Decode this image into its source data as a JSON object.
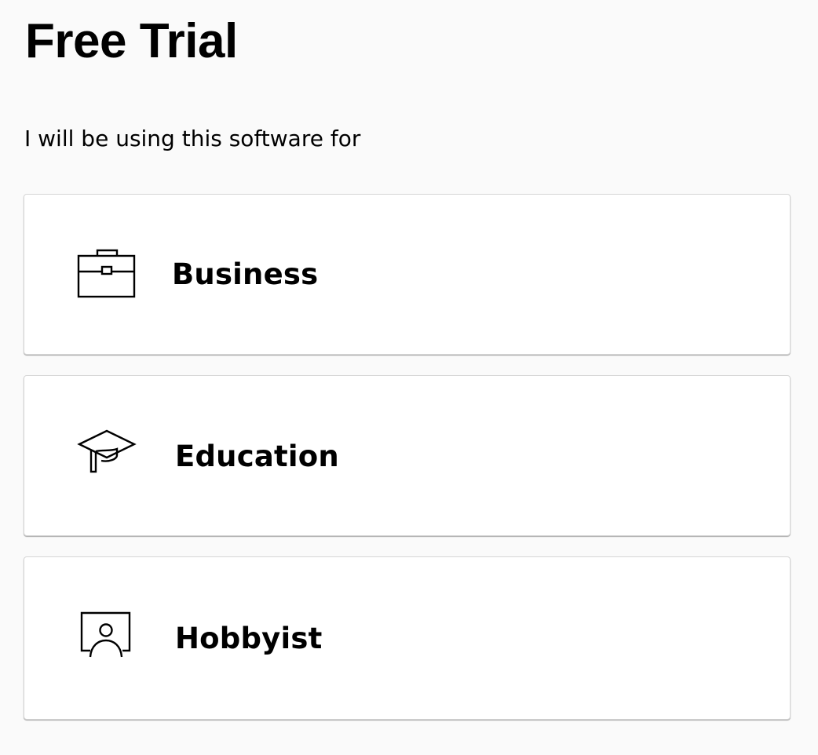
{
  "page": {
    "title": "Free Trial",
    "prompt": "I will be using this software for"
  },
  "options": [
    {
      "label": "Business",
      "icon": "briefcase-icon"
    },
    {
      "label": "Education",
      "icon": "graduation-cap-icon"
    },
    {
      "label": "Hobbyist",
      "icon": "person-frame-icon"
    }
  ],
  "colors": {
    "background": "#fafafa",
    "card": "#ffffff",
    "border": "#d6d6d6",
    "text": "#000000"
  }
}
